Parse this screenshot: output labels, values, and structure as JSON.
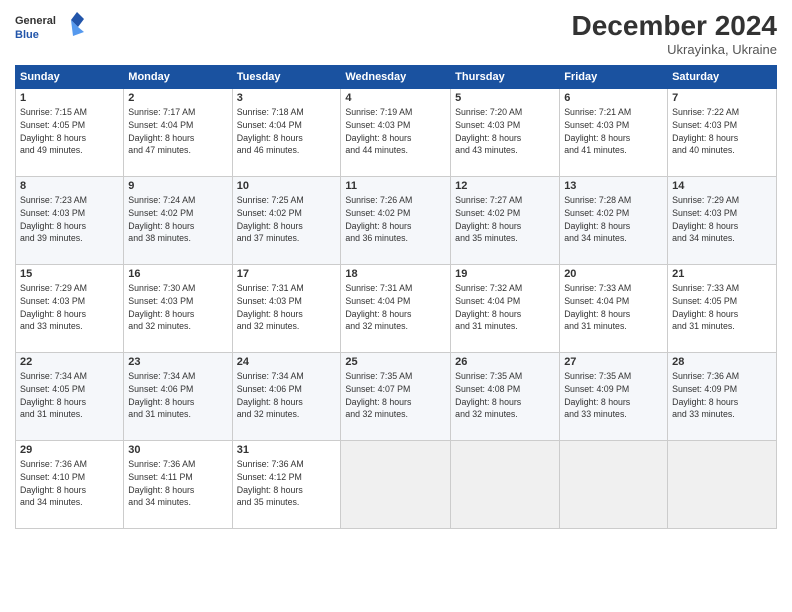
{
  "header": {
    "logo_general": "General",
    "logo_blue": "Blue",
    "month": "December 2024",
    "location": "Ukrayinka, Ukraine"
  },
  "days_of_week": [
    "Sunday",
    "Monday",
    "Tuesday",
    "Wednesday",
    "Thursday",
    "Friday",
    "Saturday"
  ],
  "weeks": [
    [
      {
        "day": 1,
        "sunrise": "7:15 AM",
        "sunset": "4:05 PM",
        "daylight": "8 hours and 49 minutes."
      },
      {
        "day": 2,
        "sunrise": "7:17 AM",
        "sunset": "4:04 PM",
        "daylight": "8 hours and 47 minutes."
      },
      {
        "day": 3,
        "sunrise": "7:18 AM",
        "sunset": "4:04 PM",
        "daylight": "8 hours and 46 minutes."
      },
      {
        "day": 4,
        "sunrise": "7:19 AM",
        "sunset": "4:03 PM",
        "daylight": "8 hours and 44 minutes."
      },
      {
        "day": 5,
        "sunrise": "7:20 AM",
        "sunset": "4:03 PM",
        "daylight": "8 hours and 43 minutes."
      },
      {
        "day": 6,
        "sunrise": "7:21 AM",
        "sunset": "4:03 PM",
        "daylight": "8 hours and 41 minutes."
      },
      {
        "day": 7,
        "sunrise": "7:22 AM",
        "sunset": "4:03 PM",
        "daylight": "8 hours and 40 minutes."
      }
    ],
    [
      {
        "day": 8,
        "sunrise": "7:23 AM",
        "sunset": "4:03 PM",
        "daylight": "8 hours and 39 minutes."
      },
      {
        "day": 9,
        "sunrise": "7:24 AM",
        "sunset": "4:02 PM",
        "daylight": "8 hours and 38 minutes."
      },
      {
        "day": 10,
        "sunrise": "7:25 AM",
        "sunset": "4:02 PM",
        "daylight": "8 hours and 37 minutes."
      },
      {
        "day": 11,
        "sunrise": "7:26 AM",
        "sunset": "4:02 PM",
        "daylight": "8 hours and 36 minutes."
      },
      {
        "day": 12,
        "sunrise": "7:27 AM",
        "sunset": "4:02 PM",
        "daylight": "8 hours and 35 minutes."
      },
      {
        "day": 13,
        "sunrise": "7:28 AM",
        "sunset": "4:02 PM",
        "daylight": "8 hours and 34 minutes."
      },
      {
        "day": 14,
        "sunrise": "7:29 AM",
        "sunset": "4:03 PM",
        "daylight": "8 hours and 34 minutes."
      }
    ],
    [
      {
        "day": 15,
        "sunrise": "7:29 AM",
        "sunset": "4:03 PM",
        "daylight": "8 hours and 33 minutes."
      },
      {
        "day": 16,
        "sunrise": "7:30 AM",
        "sunset": "4:03 PM",
        "daylight": "8 hours and 32 minutes."
      },
      {
        "day": 17,
        "sunrise": "7:31 AM",
        "sunset": "4:03 PM",
        "daylight": "8 hours and 32 minutes."
      },
      {
        "day": 18,
        "sunrise": "7:31 AM",
        "sunset": "4:04 PM",
        "daylight": "8 hours and 32 minutes."
      },
      {
        "day": 19,
        "sunrise": "7:32 AM",
        "sunset": "4:04 PM",
        "daylight": "8 hours and 31 minutes."
      },
      {
        "day": 20,
        "sunrise": "7:33 AM",
        "sunset": "4:04 PM",
        "daylight": "8 hours and 31 minutes."
      },
      {
        "day": 21,
        "sunrise": "7:33 AM",
        "sunset": "4:05 PM",
        "daylight": "8 hours and 31 minutes."
      }
    ],
    [
      {
        "day": 22,
        "sunrise": "7:34 AM",
        "sunset": "4:05 PM",
        "daylight": "8 hours and 31 minutes."
      },
      {
        "day": 23,
        "sunrise": "7:34 AM",
        "sunset": "4:06 PM",
        "daylight": "8 hours and 31 minutes."
      },
      {
        "day": 24,
        "sunrise": "7:34 AM",
        "sunset": "4:06 PM",
        "daylight": "8 hours and 32 minutes."
      },
      {
        "day": 25,
        "sunrise": "7:35 AM",
        "sunset": "4:07 PM",
        "daylight": "8 hours and 32 minutes."
      },
      {
        "day": 26,
        "sunrise": "7:35 AM",
        "sunset": "4:08 PM",
        "daylight": "8 hours and 32 minutes."
      },
      {
        "day": 27,
        "sunrise": "7:35 AM",
        "sunset": "4:09 PM",
        "daylight": "8 hours and 33 minutes."
      },
      {
        "day": 28,
        "sunrise": "7:36 AM",
        "sunset": "4:09 PM",
        "daylight": "8 hours and 33 minutes."
      }
    ],
    [
      {
        "day": 29,
        "sunrise": "7:36 AM",
        "sunset": "4:10 PM",
        "daylight": "8 hours and 34 minutes."
      },
      {
        "day": 30,
        "sunrise": "7:36 AM",
        "sunset": "4:11 PM",
        "daylight": "8 hours and 34 minutes."
      },
      {
        "day": 31,
        "sunrise": "7:36 AM",
        "sunset": "4:12 PM",
        "daylight": "8 hours and 35 minutes."
      },
      null,
      null,
      null,
      null
    ]
  ]
}
